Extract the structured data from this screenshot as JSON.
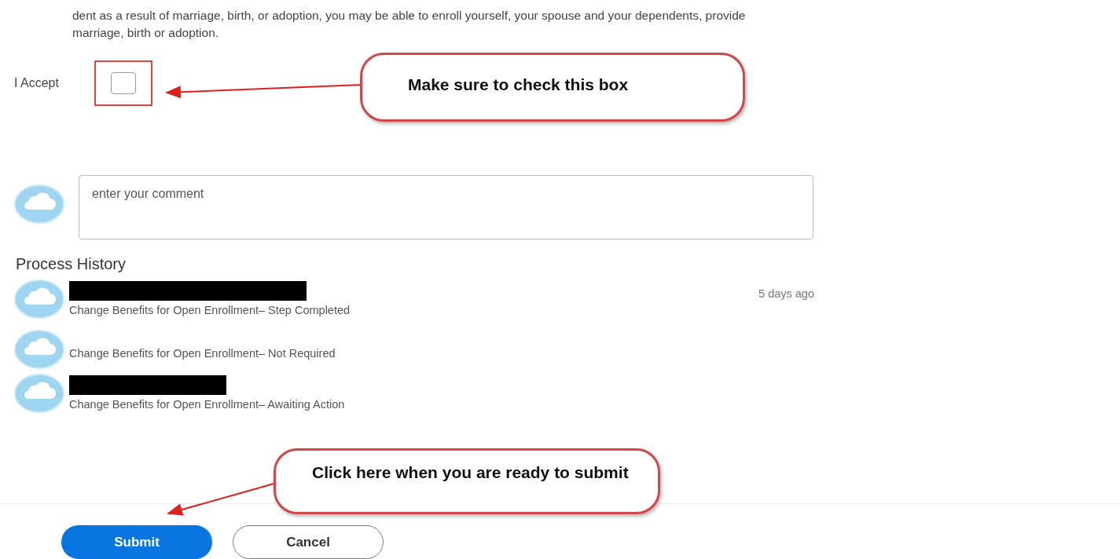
{
  "intro_lines": [
    "dent as a result of marriage, birth, or adoption, you may be able to enroll yourself, your spouse and your dependents, provide",
    "marriage, birth or adoption."
  ],
  "accept": {
    "label": "I Accept",
    "checked": false,
    "highlighted": true
  },
  "comment": {
    "placeholder": "enter your comment"
  },
  "process_history": {
    "title": "Process History",
    "items": [
      {
        "name_redacted": true,
        "time": "5 days ago",
        "status": "Change Benefits for Open Enrollment– Step Completed"
      },
      {
        "name_redacted": false,
        "status": "Change Benefits for Open Enrollment– Not Required"
      },
      {
        "name_redacted": true,
        "status": "Change Benefits for Open Enrollment– Awaiting Action"
      }
    ]
  },
  "callouts": [
    {
      "text": "Make sure to check this box"
    },
    {
      "text": "Click here when you are ready to submit"
    }
  ],
  "buttons": [
    {
      "label": "Submit",
      "kind": "primary"
    },
    {
      "label": "Cancel",
      "kind": "secondary"
    }
  ]
}
